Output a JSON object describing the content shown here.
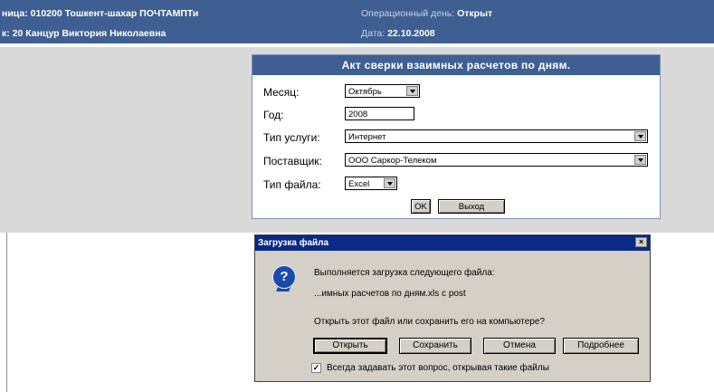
{
  "header": {
    "left_line1": "ница: 010200 Тошкент-шахар ПОЧТАМПТи",
    "left_line2": "к: 20 Канцур Виктория Николаевна",
    "right_line1_label": "Операционный день:",
    "right_line1_value": "Открыт",
    "right_line2_label": "Дата:",
    "right_line2_value": "22.10.2008"
  },
  "form": {
    "title": "Акт сверки взаимных расчетов по дням.",
    "month_label": "Месяц:",
    "month_value": "Октябрь",
    "year_label": "Год:",
    "year_value": "2008",
    "service_label": "Тип услуги:",
    "service_value": "Интернет",
    "provider_label": "Поставщик:",
    "provider_value": "ООО Саркор-Телеком",
    "filetype_label": "Тип файла:",
    "filetype_value": "Excel",
    "ok_label": "OK",
    "exit_label": "Выход"
  },
  "dialog": {
    "title": "Загрузка файла",
    "close_glyph": "×",
    "icon_glyph": "?",
    "line1": "Выполняется загрузка следующего файла:",
    "line2": "...имных расчетов по дням.xls с post",
    "question": "Открыть этот файл или сохранить его на компьютере?",
    "open_label": "Открыть",
    "save_label": "Сохранить",
    "cancel_label": "Отмена",
    "details_label": "Подробнее",
    "checkbox_mark": "✓",
    "checkbox_label": "Всегда задавать этот вопрос, открывая такие файлы",
    "checkbox_checked": true
  }
}
